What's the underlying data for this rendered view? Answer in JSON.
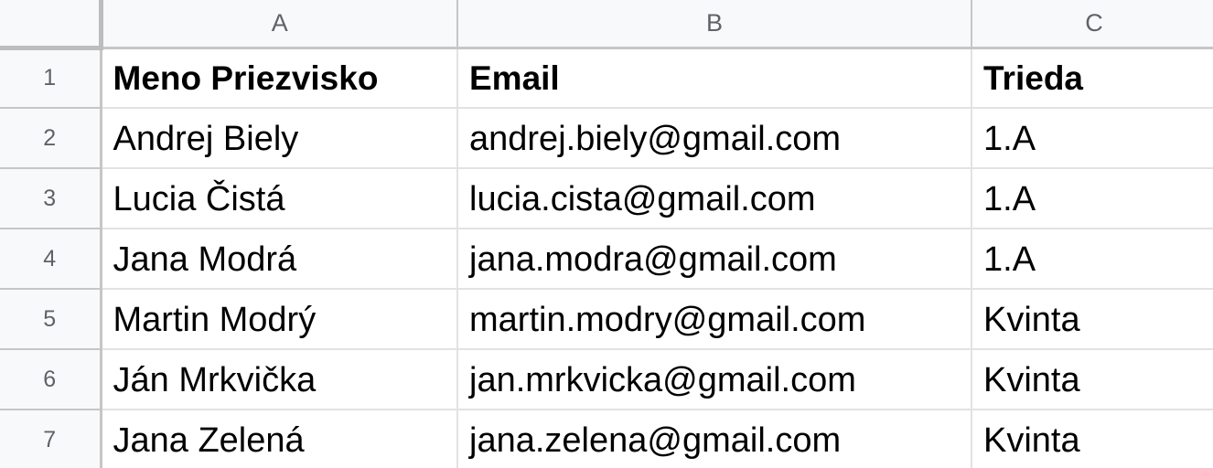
{
  "columns": [
    "A",
    "B",
    "C"
  ],
  "rows": [
    {
      "num": "1",
      "cells": [
        "Meno Priezvisko",
        "Email",
        "Trieda"
      ],
      "bold": true
    },
    {
      "num": "2",
      "cells": [
        "Andrej Biely",
        "andrej.biely@gmail.com",
        "1.A"
      ]
    },
    {
      "num": "3",
      "cells": [
        "Lucia Čistá",
        "lucia.cista@gmail.com",
        "1.A"
      ]
    },
    {
      "num": "4",
      "cells": [
        "Jana Modrá",
        "jana.modra@gmail.com",
        "1.A"
      ]
    },
    {
      "num": "5",
      "cells": [
        "Martin Modrý",
        "martin.modry@gmail.com",
        "Kvinta"
      ]
    },
    {
      "num": "6",
      "cells": [
        "Ján Mrkvička",
        "jan.mrkvicka@gmail.com",
        "Kvinta"
      ]
    },
    {
      "num": "7",
      "cells": [
        "Jana Zelená",
        "jana.zelena@gmail.com",
        "Kvinta"
      ]
    }
  ],
  "colors": {
    "header_bg": "#f8f9fa",
    "header_text": "#5f6368",
    "gridline": "#e2e2e2",
    "header_border": "#c6c6c6"
  }
}
